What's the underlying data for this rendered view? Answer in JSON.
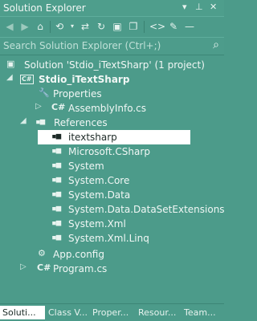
{
  "window": {
    "title": "Solution Explorer",
    "controls": [
      "▾",
      "⊥",
      "✕"
    ]
  },
  "toolbar": {
    "icons": [
      "back-icon",
      "forward-icon",
      "home-icon",
      "history-icon",
      "sync-icon",
      "refresh-icon",
      "collapse-all-icon",
      "show-all-files-icon",
      "code-icon",
      "properties-icon"
    ]
  },
  "search": {
    "placeholder": "Search Solution Explorer (Ctrl+;)"
  },
  "tree": {
    "solution": "Solution 'Stdio_iTextSharp' (1 project)",
    "project": "Stdio_iTextSharp",
    "properties": "Properties",
    "assembly_info": "AssemblyInfo.cs",
    "references": "References",
    "refs": [
      "itextsharp",
      "Microsoft.CSharp",
      "System",
      "System.Core",
      "System.Data",
      "System.Data.DataSetExtensions",
      "System.Xml",
      "System.Xml.Linq"
    ],
    "app_config": "App.config",
    "program": "Program.cs"
  },
  "bottom_tabs": [
    "Soluti...",
    "Class V...",
    "Proper...",
    "Resour...",
    "Team..."
  ]
}
